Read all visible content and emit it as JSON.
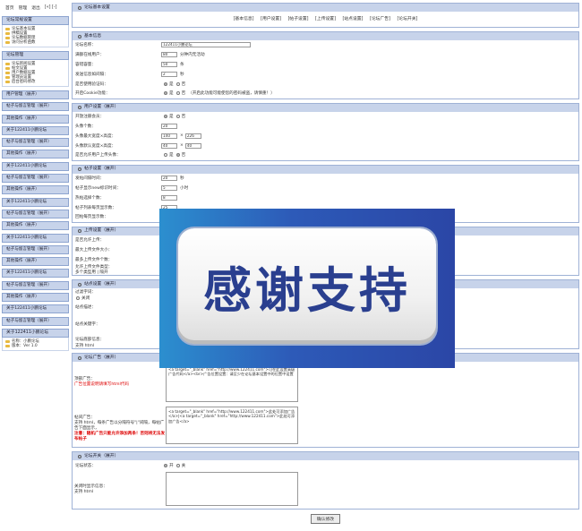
{
  "topnav": {
    "items": [
      "首页",
      "管理",
      "退出",
      "[«] [-]"
    ]
  },
  "sidebar": {
    "blocks": [
      {
        "title": "论坛常规设置",
        "items": [
          "论坛基本设置",
          "供稿设置",
          "论坛数据管理",
          "访问分析函数"
        ]
      },
      {
        "title": "论坛管理",
        "items": [
          "论坛新闻设置",
          "帖文设置",
          "用户数据设置",
          "管理员设置",
          "后台密码修改"
        ]
      }
    ],
    "links": [
      "用户管理（展开）",
      "帖子与留言管理（展开）",
      "其他操作（展开）",
      "关于122411小鹏论坛",
      "帖子与留言管理（展开）",
      "其他操作（展开）",
      "关于122411小鹏论坛",
      "帖子与留言管理（展开）",
      "其他操作（展开）",
      "关于122411小鹏论坛",
      "帖子与留言管理（展开）",
      "其他操作（展开）",
      "关于122411小鹏论坛",
      "帖子与留言管理（展开）",
      "其他操作（展开）",
      "关于122411小鹏论坛",
      "帖子与留言管理（展开）",
      "其他操作（展开）",
      "关于122411小鹏论坛",
      "帖子与留言管理（展开）"
    ],
    "about": {
      "title": "关于122411小鹏论坛",
      "items": [
        "名称：小鹏论坛",
        "版本：Ver 1.0"
      ]
    }
  },
  "main": {
    "title": "论坛基本设置",
    "tabs": [
      "[基本信息]",
      "[用户设置]",
      "[帖子设置]",
      "[上传设置]",
      "[站点设置]",
      "[论坛广告]",
      "[论坛开关]"
    ],
    "basic": {
      "title": "基本信息",
      "rows": [
        {
          "label": "论坛名称：",
          "value": "122411小鹏论坛"
        },
        {
          "label": "满额在线用户：",
          "value": "80",
          "unit": "分钟内无活动"
        },
        {
          "label": "容错容量：",
          "value": "50",
          "unit": "条"
        },
        {
          "label": "发送信息如间隔：",
          "value": "2",
          "unit": "秒"
        }
      ],
      "radio_rows": [
        {
          "label": "是否使用验证码：",
          "opt1": "是",
          "opt2": "否",
          "note": ""
        },
        {
          "label": "开启Cookie功能：",
          "opt1": "是",
          "opt2": "否",
          "note": "（开启此功能可能使您的密码被盗，请慎重！）"
        }
      ]
    },
    "user": {
      "title": "用户设置（展开）",
      "rows": [
        {
          "label": "开放注册会员：",
          "kind": "radio",
          "opt1": "是",
          "opt2": "否"
        },
        {
          "label": "头像个数：",
          "value": "20"
        },
        {
          "label": "头像最大宽度×高度：",
          "value": "140",
          "value2": "226"
        },
        {
          "label": "头像默认宽度×高度：",
          "value": "40",
          "value2": "40"
        },
        {
          "label": "是否允许用户上传头像：",
          "kind": "radio",
          "opt1": "是",
          "opt2": "否"
        }
      ]
    },
    "post": {
      "title": "帖子设置（展开）",
      "rows": [
        {
          "label": "发帖间隔时间：",
          "value": "20",
          "unit": "秒"
        },
        {
          "label": "帖子显示new标识时间：",
          "value": "5",
          "unit": "小时"
        },
        {
          "label": "热帖选择个数：",
          "value": "8"
        },
        {
          "label": "帖子列表每页显示数：",
          "value": "25"
        },
        {
          "label": "回帖每页显示数：",
          "value": ""
        }
      ]
    },
    "upload": {
      "title": "上传设置（展开）",
      "rows": [
        "是否允许上传：",
        "最大上传文件大小：",
        "最多上传文件个数：",
        "允许上传文件类型：",
        "多个类型用 | 隔开"
      ]
    },
    "site": {
      "title": "站点设置（展开）",
      "rows": [
        "过滤字词：",
        "关闭",
        "站点描述：",
        "站点关键字：",
        "论坛底部信息：",
        "支持 html"
      ]
    },
    "ads": {
      "title": "论坛广告（展开）",
      "top_label": "顶部广告：",
      "top_hint": "广告位置说明请填写html代码",
      "top_code": "<a target=\"_blank\" href=\"http://www.122411.com\">可在此设置高级广告代码</a><br>广告位置设置：请至少在论坛基本设置中的位置中设置",
      "bottom_label": "帖间广告：",
      "bottom_hint1": "支持 html，每条广告以分隔符号\"|\"间隔，每帖广告下面显示，",
      "bottom_hint2": "注意：随机广告只能允许添加两条！否则将无法发布帖子",
      "bottom_code": "<a target=\"_blank\" href=\"http://www.122411.com\">此处可添加广告</a>|<a target=\"_blank\" href=\"http://www.122411.com\">此处可添加广告</a>"
    },
    "switch": {
      "title": "论坛开关（展开）",
      "status_label": "论坛状态：",
      "opt1": "开",
      "opt2": "关",
      "msg_label": "关闭时显示信息：",
      "msg_hint": "支持 html"
    },
    "submit_label": "确认修改"
  },
  "overlay": {
    "text": "感谢支持"
  },
  "colors": {
    "header_bg": "#c7d3ea",
    "border": "#8da4cf",
    "red": "#dd0000",
    "overlay_blue": "#2b46a6"
  }
}
